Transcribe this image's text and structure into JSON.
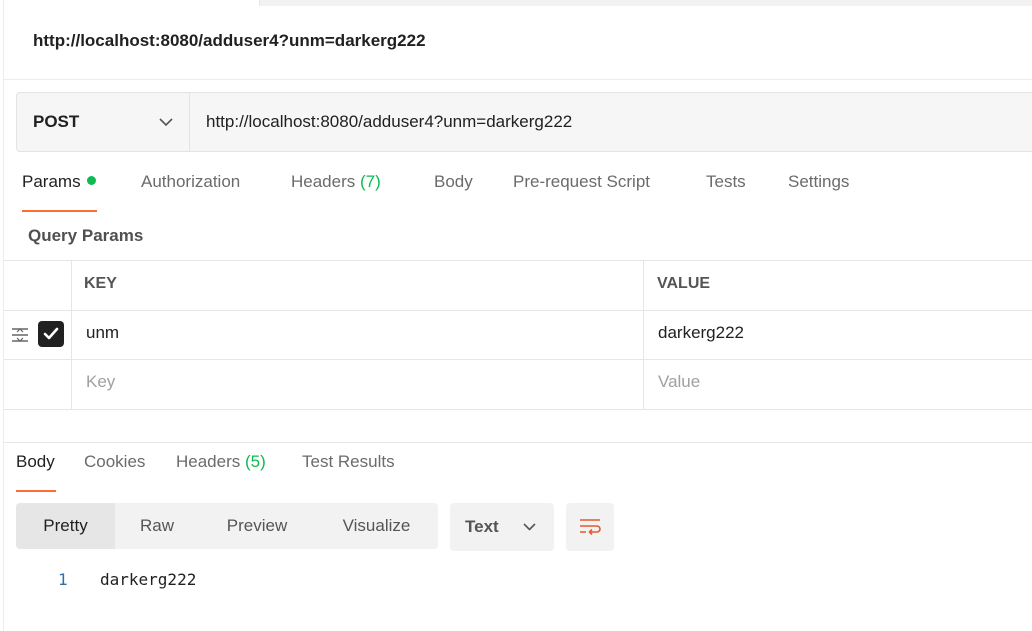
{
  "request": {
    "title": "http://localhost:8080/adduser4?unm=darkerg222",
    "method": "POST",
    "url": "http://localhost:8080/adduser4?unm=darkerg222"
  },
  "request_tabs": [
    {
      "label": "Params",
      "active": true,
      "indicator": "green-dot"
    },
    {
      "label": "Authorization"
    },
    {
      "label": "Headers",
      "count": "(7)"
    },
    {
      "label": "Body"
    },
    {
      "label": "Pre-request Script"
    },
    {
      "label": "Tests"
    },
    {
      "label": "Settings"
    }
  ],
  "query_params": {
    "section_label": "Query Params",
    "columns": [
      "KEY",
      "VALUE"
    ],
    "rows": [
      {
        "key": "unm",
        "value": "darkerg222",
        "checked": true
      }
    ],
    "key_placeholder": "Key",
    "value_placeholder": "Value"
  },
  "response_tabs": [
    {
      "label": "Body",
      "active": true
    },
    {
      "label": "Cookies"
    },
    {
      "label": "Headers",
      "count": "(5)"
    },
    {
      "label": "Test Results"
    }
  ],
  "view_modes": [
    "Pretty",
    "Raw",
    "Preview",
    "Visualize"
  ],
  "active_view_mode": "Pretty",
  "format": "Text",
  "response_body": [
    {
      "line": "1",
      "text": "darkerg222"
    }
  ],
  "colors": {
    "accent": "#ff6c37",
    "success": "#0cbb52",
    "line_number": "#2d6fa6"
  },
  "icons": {
    "method_dropdown": "chevron-down-icon",
    "drag_handle": "drag-handle-icon",
    "checkbox": "checkmark-icon",
    "format_dropdown": "chevron-down-icon",
    "wrap": "wrap-lines-icon"
  }
}
